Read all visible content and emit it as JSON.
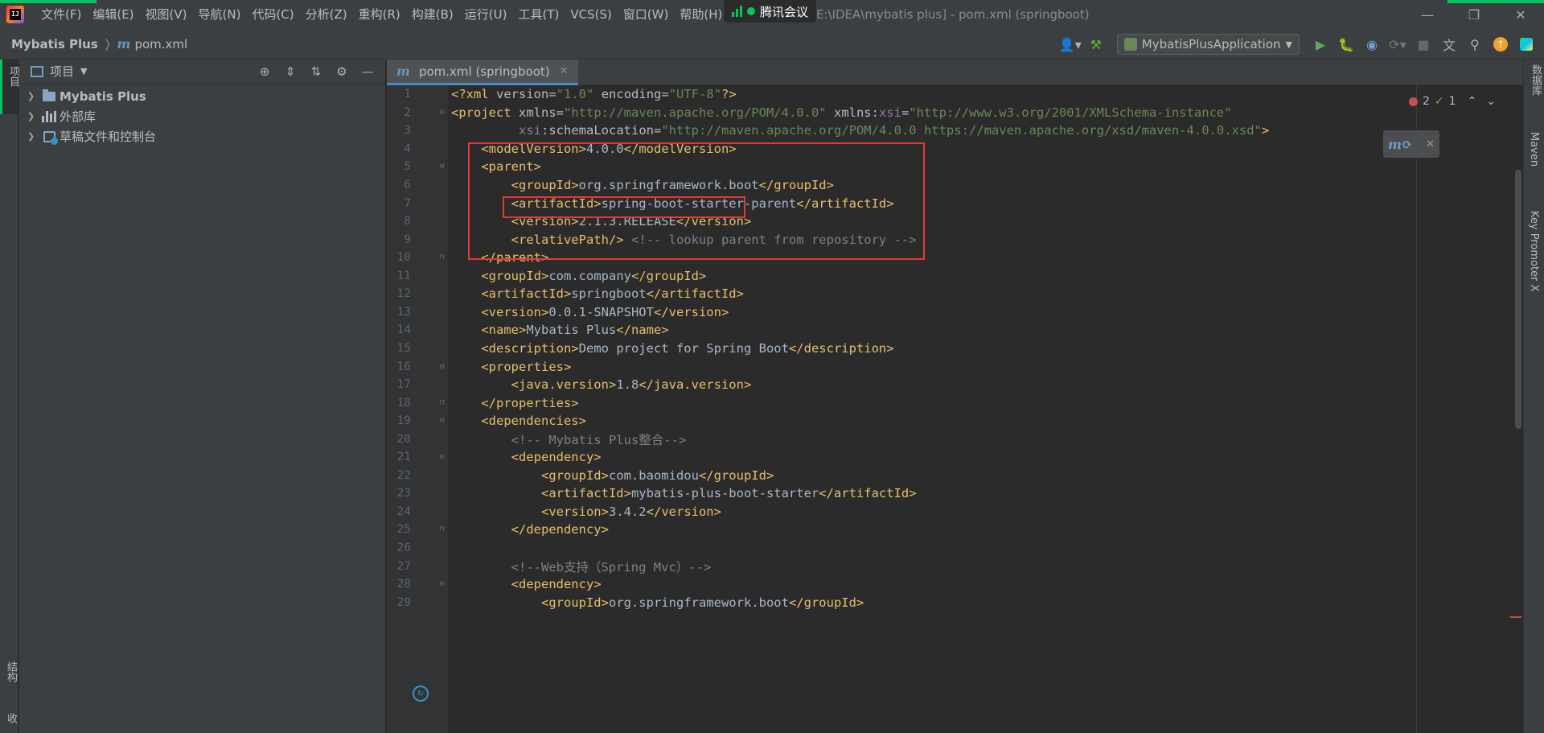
{
  "title_bar": {
    "menu": [
      "文件(F)",
      "编辑(E)",
      "视图(V)",
      "导航(N)",
      "代码(C)",
      "分析(Z)",
      "重构(R)",
      "构建(B)",
      "运行(U)",
      "工具(T)",
      "VCS(S)",
      "窗口(W)",
      "帮助(H)"
    ],
    "meeting_label": "腾讯会议",
    "window_title": "E:\\IDEA\\mybatis plus] - pom.xml (springboot)"
  },
  "navbar": {
    "project": "Mybatis Plus",
    "file": "pom.xml",
    "run_config": "MybatisPlusApplication"
  },
  "left_strip": {
    "project_tab": "项目",
    "structure_tab": "结构",
    "bookmarks_tab": "收"
  },
  "project_panel": {
    "title": "项目",
    "tree": [
      {
        "label": "Mybatis Plus",
        "bold": true,
        "icon": "folder-icon"
      },
      {
        "label": "外部库",
        "bold": false,
        "icon": "library-icon"
      },
      {
        "label": "草稿文件和控制台",
        "bold": false,
        "icon": "scratch-icon"
      }
    ]
  },
  "editor": {
    "tab_label": "pom.xml (springboot)",
    "inspection": {
      "errors": "2",
      "warnings": "1"
    },
    "lines": [
      {
        "n": "1",
        "fold": "",
        "html": "<span class=\"t-tag\">&lt;?xml</span> <span class=\"t-attr\">version</span><span class=\"t-txt\">=</span><span class=\"t-str\">\"1.0\"</span> <span class=\"t-attr\">encoding</span><span class=\"t-txt\">=</span><span class=\"t-str\">\"UTF-8\"</span><span class=\"t-tag\">?&gt;</span>"
      },
      {
        "n": "2",
        "fold": "open",
        "html": "<span class=\"t-tag\">&lt;project</span> <span class=\"t-attr\">xmlns</span><span class=\"t-txt\">=</span><span class=\"t-str\">\"http://maven.apache.org/POM/4.0.0\"</span> <span class=\"t-attr\">xmlns:</span><span class=\"t-ns\">xsi</span><span class=\"t-txt\">=</span><span class=\"t-str\">\"http://www.w3.org/2001/XMLSchema-instance\"</span>"
      },
      {
        "n": "3",
        "fold": "",
        "html": "         <span class=\"t-ns\">xsi</span><span class=\"t-attr\">:schemaLocation</span><span class=\"t-txt\">=</span><span class=\"t-str\">\"http://maven.apache.org/POM/4.0.0 https://maven.apache.org/xsd/maven-4.0.0.xsd\"</span><span class=\"t-tag\">&gt;</span>"
      },
      {
        "n": "4",
        "fold": "",
        "html": "    <span class=\"t-tag\">&lt;modelVersion&gt;</span><span class=\"t-txt\">4.0.0</span><span class=\"t-tag\">&lt;/modelVersion&gt;</span>"
      },
      {
        "n": "5",
        "fold": "open",
        "html": "    <span class=\"t-tag\">&lt;parent&gt;</span>"
      },
      {
        "n": "6",
        "fold": "",
        "html": "        <span class=\"t-tag\">&lt;groupId&gt;</span><span class=\"t-txt\">org.springframework.boot</span><span class=\"t-tag\">&lt;/groupId&gt;</span>"
      },
      {
        "n": "7",
        "fold": "",
        "html": "        <span class=\"t-tag\">&lt;artifactId&gt;</span><span class=\"t-txt\">spring-boot-starter-parent</span><span class=\"t-tag\">&lt;/artifactId&gt;</span>"
      },
      {
        "n": "8",
        "fold": "",
        "html": "        <span class=\"t-tag\">&lt;version&gt;</span><span class=\"t-txt\">2.1.3.RELEASE</span><span class=\"t-tag\">&lt;/version&gt;</span>"
      },
      {
        "n": "9",
        "fold": "",
        "html": "        <span class=\"t-tag\">&lt;relativePath/&gt;</span> <span class=\"t-cmt\">&lt;!-- lookup parent from repository --&gt;</span>"
      },
      {
        "n": "10",
        "fold": "close",
        "html": "    <span class=\"t-tag\">&lt;/parent&gt;</span>"
      },
      {
        "n": "11",
        "fold": "",
        "html": "    <span class=\"t-tag\">&lt;groupId&gt;</span><span class=\"t-txt\">com.company</span><span class=\"t-tag\">&lt;/groupId&gt;</span>"
      },
      {
        "n": "12",
        "fold": "",
        "html": "    <span class=\"t-tag\">&lt;artifactId&gt;</span><span class=\"t-txt\">springboot</span><span class=\"t-tag\">&lt;/artifactId&gt;</span>"
      },
      {
        "n": "13",
        "fold": "",
        "html": "    <span class=\"t-tag\">&lt;version&gt;</span><span class=\"t-txt\">0.0.1-SNAPSHOT</span><span class=\"t-tag\">&lt;/version&gt;</span>"
      },
      {
        "n": "14",
        "fold": "",
        "html": "    <span class=\"t-tag\">&lt;name&gt;</span><span class=\"t-txt\">Mybatis Plus</span><span class=\"t-tag\">&lt;/name&gt;</span>"
      },
      {
        "n": "15",
        "fold": "",
        "html": "    <span class=\"t-tag\">&lt;description&gt;</span><span class=\"t-txt\">Demo project for Spring Boot</span><span class=\"t-tag\">&lt;/description&gt;</span>"
      },
      {
        "n": "16",
        "fold": "open",
        "html": "    <span class=\"t-tag\">&lt;properties&gt;</span>"
      },
      {
        "n": "17",
        "fold": "",
        "html": "        <span class=\"t-tag\">&lt;java.version&gt;</span><span class=\"t-txt\">1.8</span><span class=\"t-tag\">&lt;/java.version&gt;</span>"
      },
      {
        "n": "18",
        "fold": "close",
        "html": "    <span class=\"t-tag\">&lt;/properties&gt;</span>"
      },
      {
        "n": "19",
        "fold": "open",
        "html": "    <span class=\"t-tag\">&lt;dependencies&gt;</span>"
      },
      {
        "n": "20",
        "fold": "",
        "html": "        <span class=\"t-cmt\">&lt;!-- Mybatis Plus整合--&gt;</span>"
      },
      {
        "n": "21",
        "fold": "open",
        "html": "        <span class=\"t-tag\">&lt;dependency&gt;</span>"
      },
      {
        "n": "22",
        "fold": "",
        "html": "            <span class=\"t-tag\">&lt;groupId&gt;</span><span class=\"t-txt\">com.baomidou</span><span class=\"t-tag\">&lt;/groupId&gt;</span>"
      },
      {
        "n": "23",
        "fold": "",
        "html": "            <span class=\"t-tag\">&lt;artifactId&gt;</span><span class=\"t-txt\">mybatis-plus-boot-starter</span><span class=\"t-tag\">&lt;/artifactId&gt;</span>"
      },
      {
        "n": "24",
        "fold": "",
        "html": "            <span class=\"t-tag\">&lt;version&gt;</span><span class=\"t-txt\">3.4.2</span><span class=\"t-tag\">&lt;/version&gt;</span>"
      },
      {
        "n": "25",
        "fold": "close",
        "html": "        <span class=\"t-tag\">&lt;/dependency&gt;</span>"
      },
      {
        "n": "26",
        "fold": "",
        "html": ""
      },
      {
        "n": "27",
        "fold": "",
        "html": "        <span class=\"t-cmt\">&lt;!--Web支持（Spring Mvc）--&gt;</span>"
      },
      {
        "n": "28",
        "fold": "open",
        "html": "        <span class=\"t-tag\">&lt;dependency&gt;</span>"
      },
      {
        "n": "29",
        "fold": "",
        "html": "            <span class=\"t-tag\">&lt;groupId&gt;</span><span class=\"t-txt\">org.springframework.boot</span><span class=\"t-tag\">&lt;/groupId&gt;</span>"
      }
    ]
  },
  "right_strip": {
    "database_tab": "数据库",
    "maven_tab": "Maven",
    "key_promoter_tab": "Key Promoter X"
  },
  "colors": {
    "accent_green": "#09c45a",
    "highlight_red": "#e53935",
    "tag": "#e8bf6a",
    "string": "#6a8759",
    "comment": "#808080"
  }
}
